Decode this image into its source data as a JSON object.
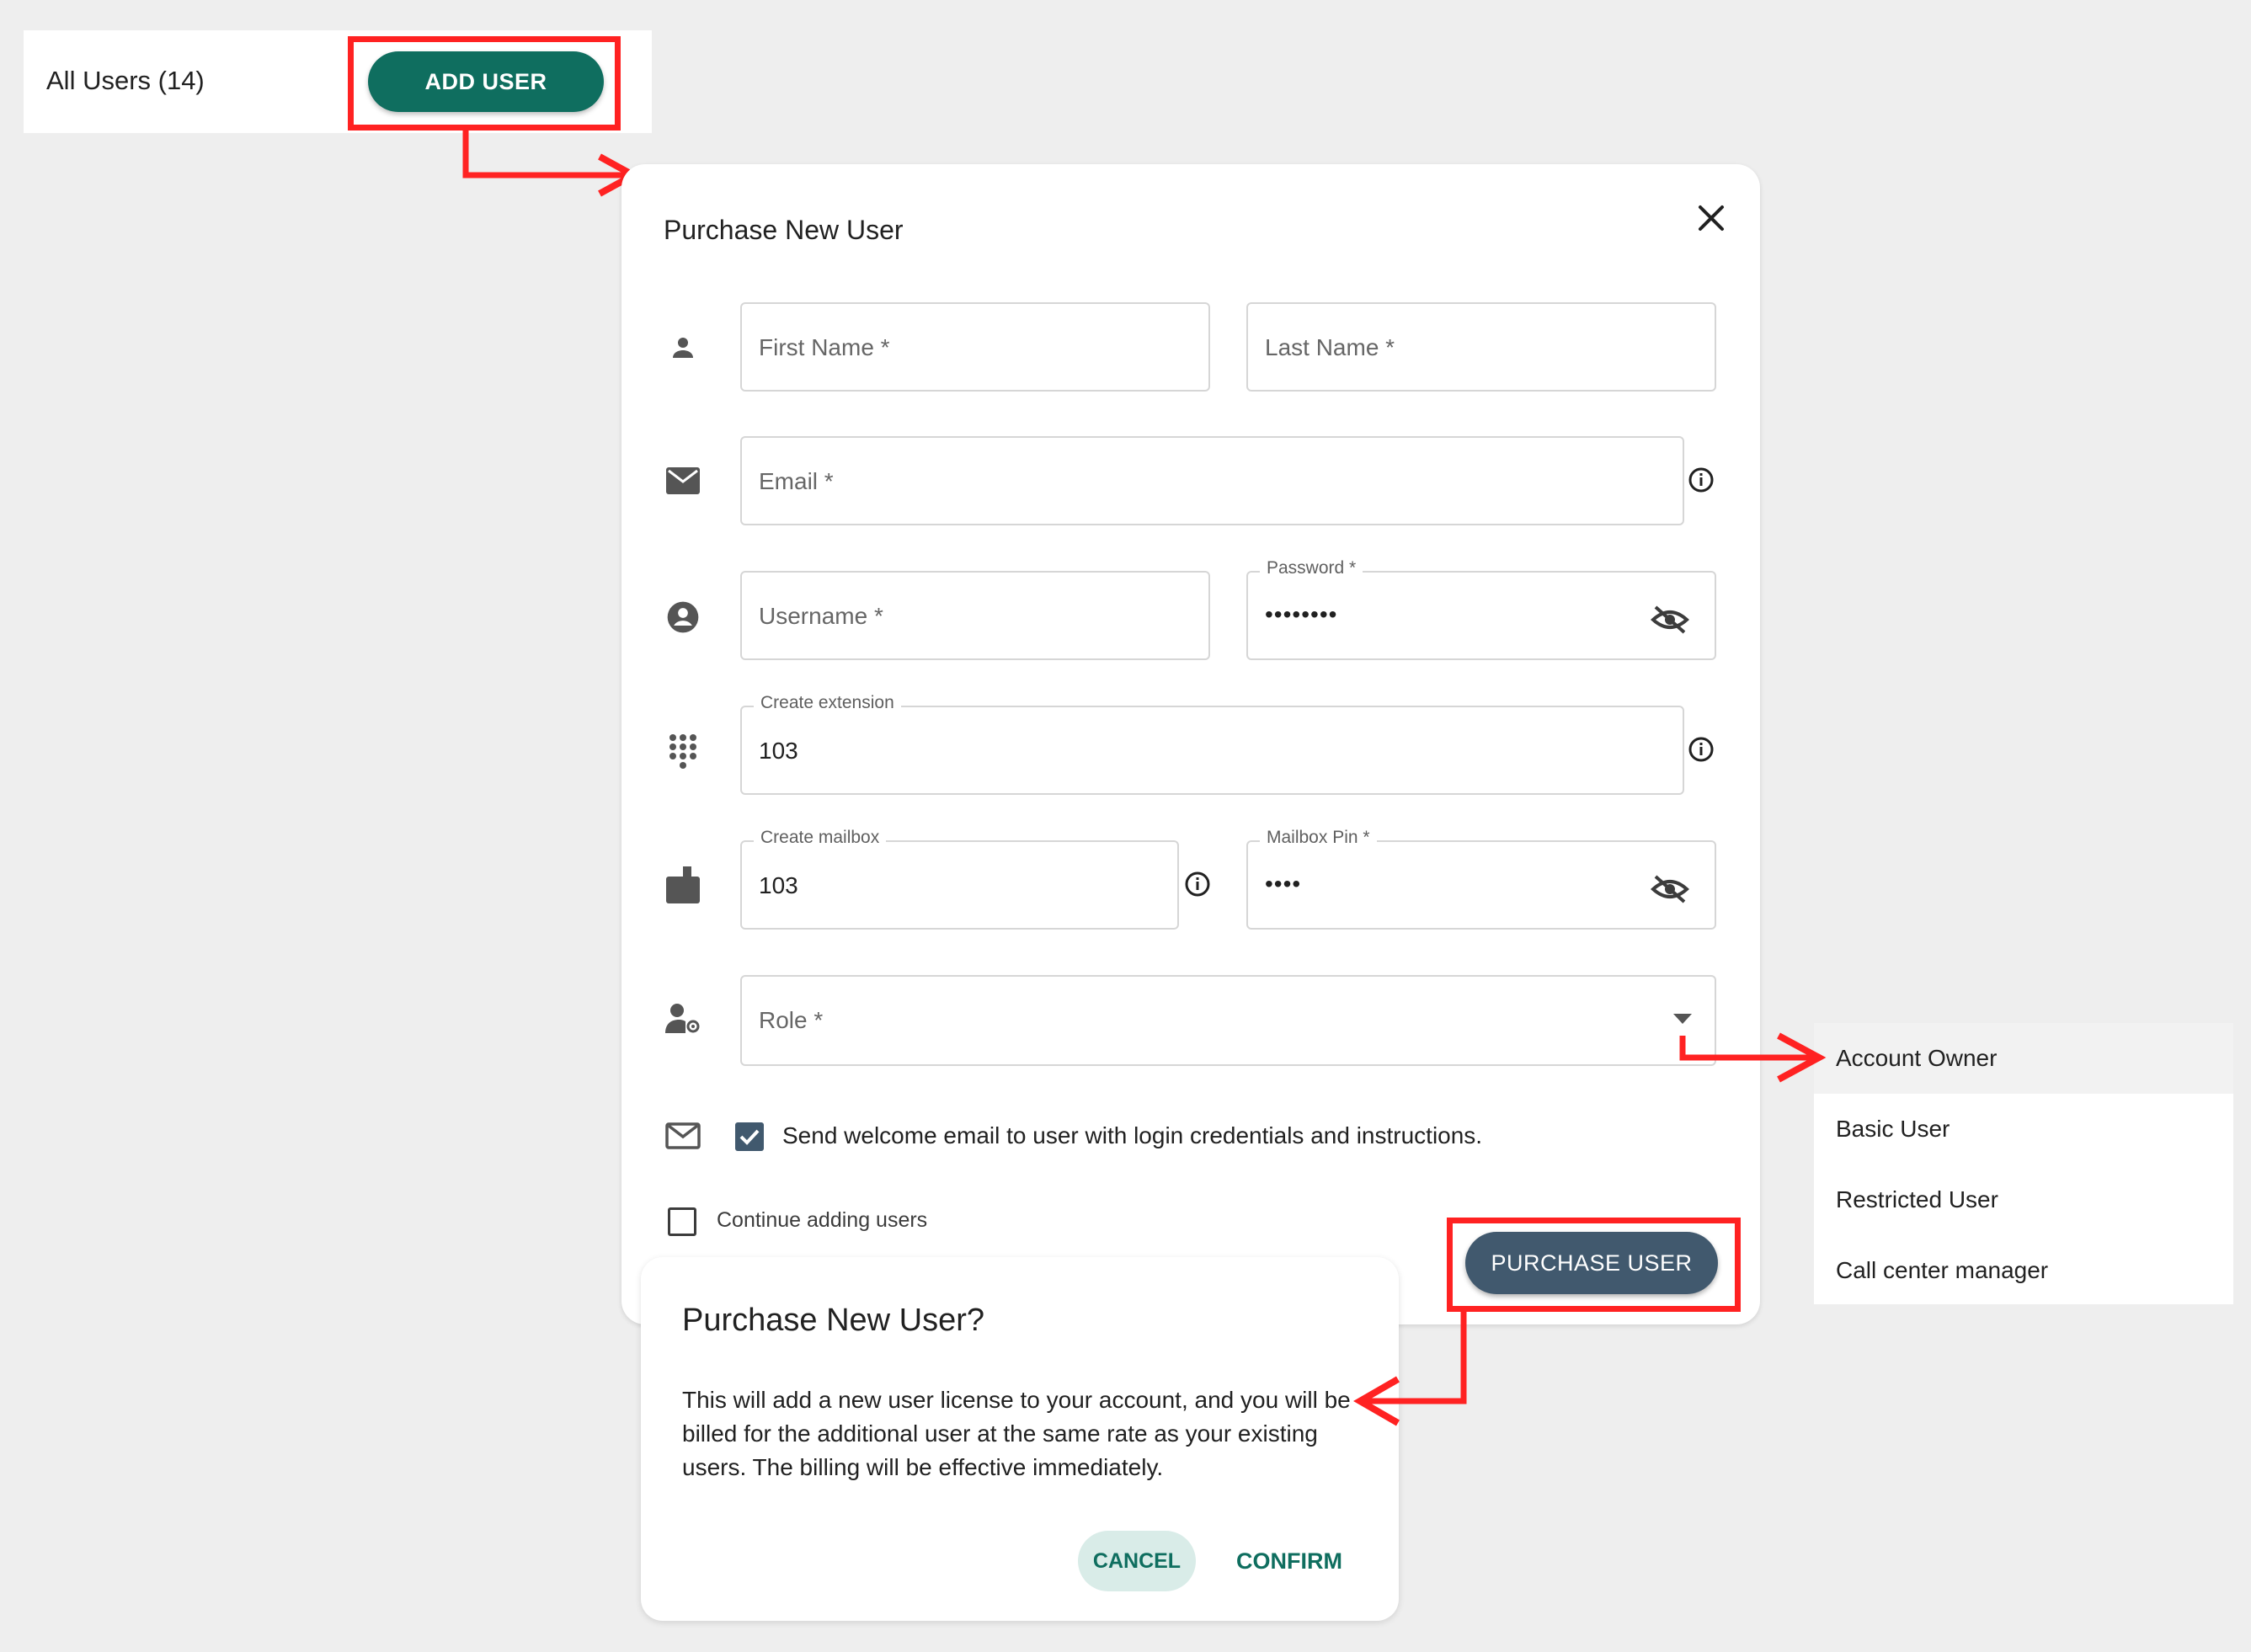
{
  "header": {
    "title": "All Users (14)",
    "add_user_label": "ADD USER"
  },
  "dialog": {
    "title": "Purchase New User",
    "fields": {
      "first_name": {
        "placeholder": "First Name *"
      },
      "last_name": {
        "placeholder": "Last Name *"
      },
      "email": {
        "placeholder": "Email *"
      },
      "username": {
        "placeholder": "Username *"
      },
      "password": {
        "label": "Password *",
        "value": "••••••••"
      },
      "extension": {
        "label": "Create extension",
        "value": "103"
      },
      "mailbox": {
        "label": "Create mailbox",
        "value": "103"
      },
      "mailbox_pin": {
        "label": "Mailbox Pin *",
        "value": "••••"
      },
      "role": {
        "placeholder": "Role *"
      }
    },
    "welcome_email": {
      "label": "Send welcome email to user with login credentials and instructions.",
      "checked": true
    },
    "continue_adding": {
      "label": "Continue adding users",
      "checked": false
    },
    "purchase_label": "PURCHASE USER"
  },
  "role_menu": {
    "items": [
      "Account Owner",
      "Basic User",
      "Restricted User",
      "Call center manager"
    ]
  },
  "confirm_dialog": {
    "title": "Purchase New User?",
    "text": "This will add a new user license to your account, and you will be billed for the additional user at the same rate as your existing users. The billing will be effective immediately.",
    "cancel_label": "CANCEL",
    "confirm_label": "CONFIRM"
  },
  "colors": {
    "primary_green": "#0f6e5f",
    "purchase_button": "#41596e",
    "annotation_red": "#ff2222",
    "background": "#eeeeee"
  }
}
